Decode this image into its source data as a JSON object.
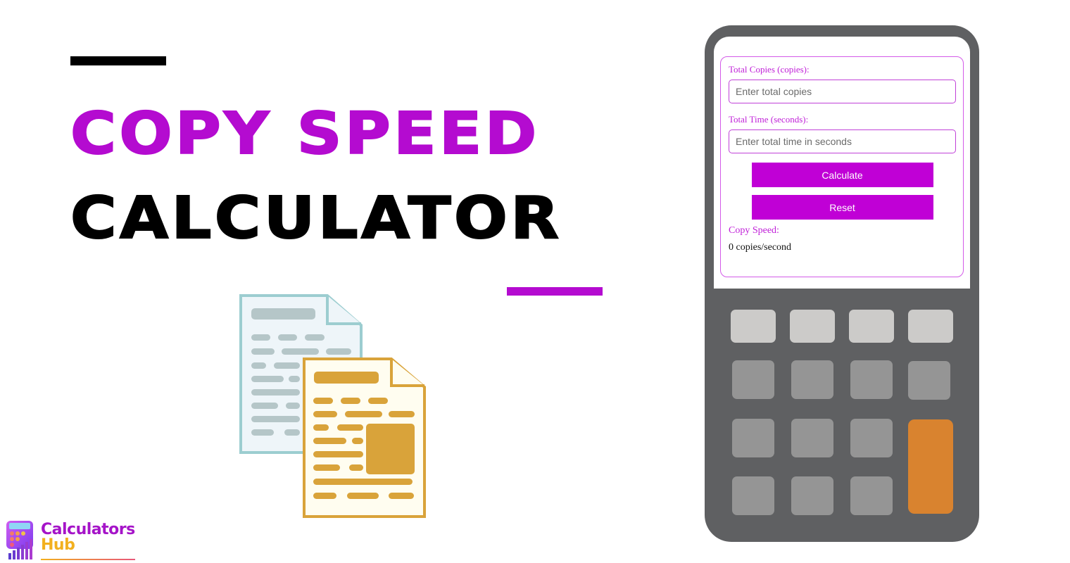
{
  "page": {
    "title_line_1": "COPY SPEED",
    "title_line_2": "CALCULATOR"
  },
  "brand": {
    "name_line_1": "Calculators",
    "name_line_2": "Hub"
  },
  "calculator": {
    "fields": [
      {
        "label": "Total Copies (copies):",
        "value": "",
        "placeholder": "Enter total copies"
      },
      {
        "label": "Total Time (seconds):",
        "value": "",
        "placeholder": "Enter total time in seconds"
      }
    ],
    "buttons": {
      "calculate": "Calculate",
      "reset": "Reset"
    },
    "result": {
      "label": "Copy Speed:",
      "value": "0 copies/second"
    }
  },
  "colors": {
    "accent": "#b40bd0",
    "button": "#c000d6",
    "calculator_body": "#5f6062",
    "key_light": "#cccbc9",
    "key_mid": "#959595",
    "key_orange": "#d9832f"
  },
  "icons": {
    "illustration": "copy-documents-icon",
    "logo": "calculator-chart-icon"
  }
}
